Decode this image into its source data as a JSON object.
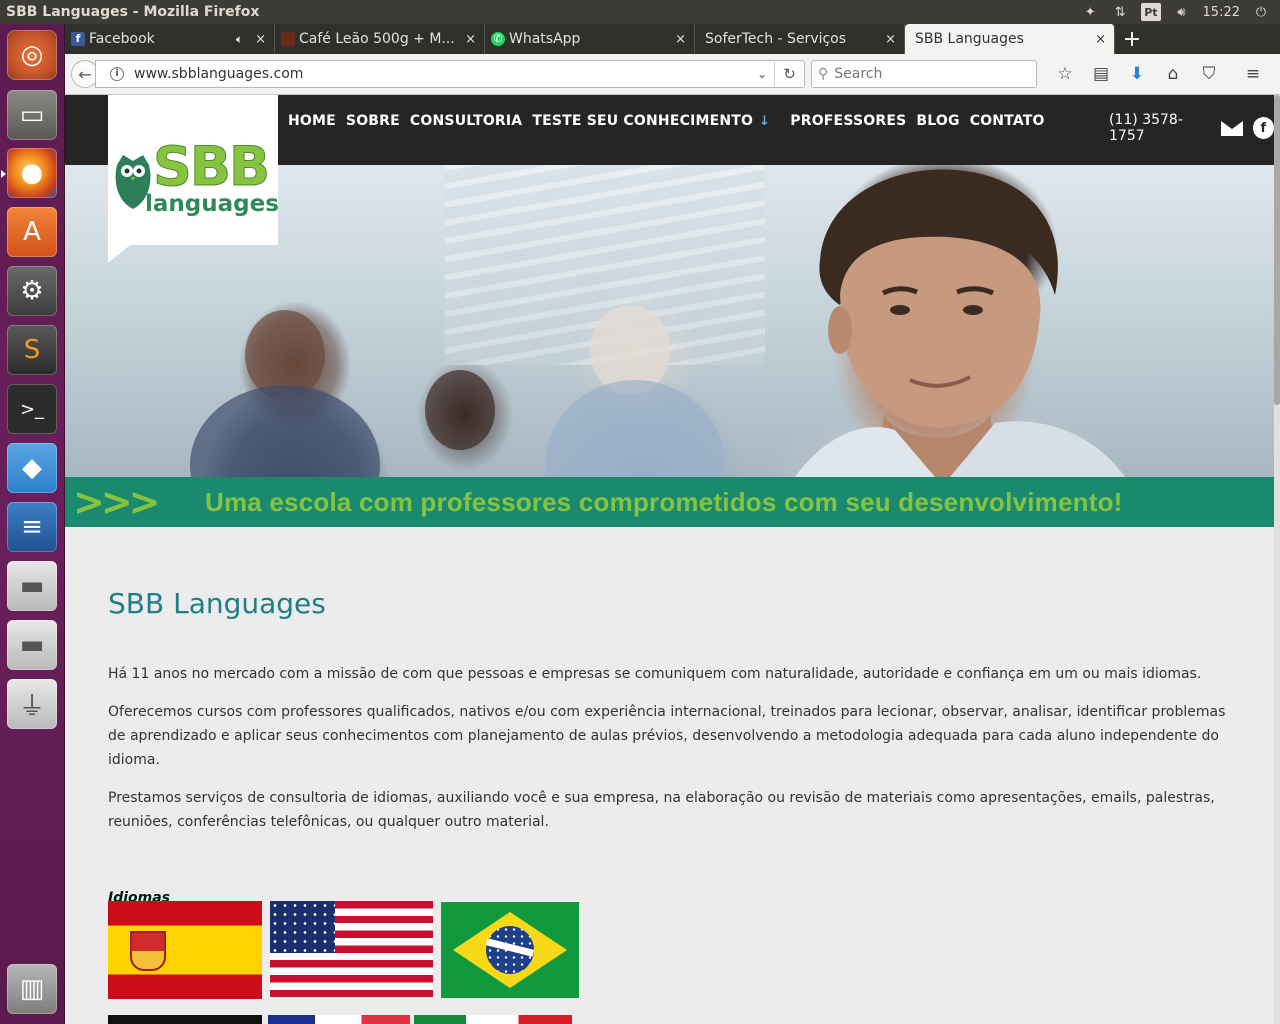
{
  "system": {
    "window_title": "SBB Languages - Mozilla Firefox",
    "keyboard_layout": "Pt",
    "clock": "15:22",
    "icons": [
      "dropbox-status-icon",
      "network-icon",
      "keyboard-icon",
      "volume-icon",
      "power-icon"
    ]
  },
  "launcher": {
    "items": [
      {
        "name": "ubuntu-dash",
        "glyph": "◎"
      },
      {
        "name": "files",
        "glyph": "▭"
      },
      {
        "name": "firefox",
        "glyph": "●"
      },
      {
        "name": "ubuntu-software",
        "glyph": "A"
      },
      {
        "name": "system-settings",
        "glyph": "⚙"
      },
      {
        "name": "sublime-text",
        "glyph": "S"
      },
      {
        "name": "terminal",
        "glyph": ">_"
      },
      {
        "name": "dropbox",
        "glyph": "◆"
      },
      {
        "name": "libreoffice-writer",
        "glyph": "≡"
      },
      {
        "name": "hard-drive-1",
        "glyph": "▬"
      },
      {
        "name": "hard-drive-2",
        "glyph": "▬"
      },
      {
        "name": "usb-drive",
        "glyph": "⏚"
      },
      {
        "name": "trash",
        "glyph": "▥"
      }
    ]
  },
  "browser": {
    "tabs": [
      {
        "label": "Facebook",
        "favicon_color": "#3b5998",
        "favicon_glyph": "f",
        "audio": true
      },
      {
        "label": "Café Leão 500g + M...",
        "favicon_color": "#6b2b1a",
        "favicon_glyph": "",
        "audio": false
      },
      {
        "label": "WhatsApp",
        "favicon_color": "#25d366",
        "favicon_glyph": "✆",
        "audio": false
      },
      {
        "label": "SoferTech - Serviços",
        "favicon_color": "",
        "favicon_glyph": "",
        "audio": false
      },
      {
        "label": "SBB Languages",
        "favicon_color": "",
        "favicon_glyph": "",
        "audio": false,
        "active": true
      }
    ],
    "url": "www.sbblanguages.com",
    "search_placeholder": "Search",
    "close_glyph": "×",
    "newtab_glyph": "+"
  },
  "site": {
    "nav": [
      "HOME",
      "SOBRE",
      "CONSULTORIA",
      "TESTE SEU CONHECIMENTO",
      "PROFESSORES",
      "BLOG",
      "CONTATO"
    ],
    "nav_test_icon": "↓",
    "phone": "(11) 3578-1757",
    "fb_glyph": "f",
    "logo_main": "SBB",
    "logo_sub": "languages",
    "banner_arrows": ">>>",
    "banner_text": "Uma escola com professores comprometidos com seu desenvolvimento!",
    "section_title": "SBB Languages",
    "paragraphs": [
      "Há 11 anos no mercado com a missão de com que pessoas e empresas se comuniquem com naturalidade, autoridade e confiança em um ou mais idiomas.",
      "Oferecemos cursos com professores qualificados, nativos e/ou com experiência internacional, treinados para lecionar, observar, analisar, identificar problemas de aprendizado e aplicar seus conhecimentos com planejamento de aulas prévios, desenvolvendo a metodologia adequada para cada aluno independente do idioma.",
      "Prestamos serviços de consultoria de idiomas, auxiliando você e sua empresa, na elaboração ou revisão de materiais como apresentações, emails, palestras, reuniões, conferências telefônicas, ou qualquer outro material."
    ],
    "idiomas_label": "Idiomas",
    "flags": [
      "spain",
      "usa",
      "brazil",
      "germany",
      "france",
      "italy"
    ],
    "colors": {
      "header": "#252525",
      "banner": "#1a8a6e",
      "accent_green": "#86c340",
      "title_teal": "#1f7f86"
    }
  }
}
